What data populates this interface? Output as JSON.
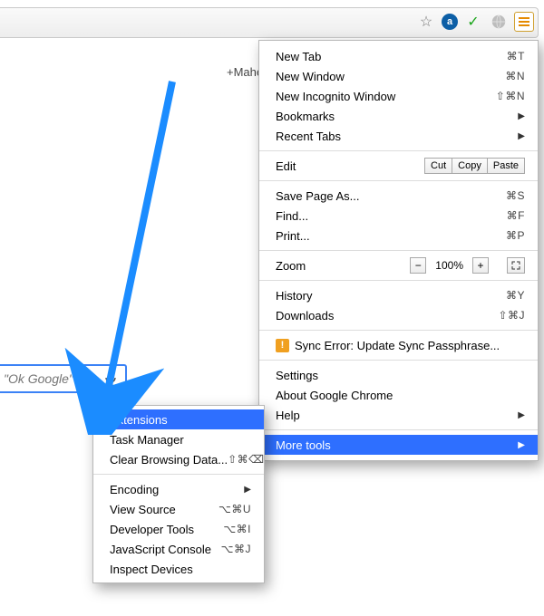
{
  "toolbar": {
    "star": "☆",
    "a": "a",
    "check": "✓"
  },
  "userlink": "+Mahesh",
  "search": {
    "placeholder": "\"Ok Google\""
  },
  "menu": {
    "newtab": {
      "label": "New Tab",
      "sc": "⌘T"
    },
    "newwin": {
      "label": "New Window",
      "sc": "⌘N"
    },
    "incog": {
      "label": "New Incognito Window",
      "sc": "⇧⌘N"
    },
    "bookmarks": {
      "label": "Bookmarks"
    },
    "recent": {
      "label": "Recent Tabs"
    },
    "edit": {
      "label": "Edit",
      "cut": "Cut",
      "copy": "Copy",
      "paste": "Paste"
    },
    "save": {
      "label": "Save Page As...",
      "sc": "⌘S"
    },
    "find": {
      "label": "Find...",
      "sc": "⌘F"
    },
    "print": {
      "label": "Print...",
      "sc": "⌘P"
    },
    "zoom": {
      "label": "Zoom",
      "minus": "−",
      "pct": "100%",
      "plus": "+"
    },
    "history": {
      "label": "History",
      "sc": "⌘Y"
    },
    "downloads": {
      "label": "Downloads",
      "sc": "⇧⌘J"
    },
    "sync": {
      "label": "Sync Error: Update Sync Passphrase..."
    },
    "settings": {
      "label": "Settings"
    },
    "about": {
      "label": "About Google Chrome"
    },
    "help": {
      "label": "Help"
    },
    "more": {
      "label": "More tools"
    }
  },
  "submenu": {
    "ext": {
      "label": "Extensions"
    },
    "task": {
      "label": "Task Manager"
    },
    "clear": {
      "label": "Clear Browsing Data...",
      "sc": "⇧⌘⌫"
    },
    "enc": {
      "label": "Encoding"
    },
    "vsrc": {
      "label": "View Source",
      "sc": "⌥⌘U"
    },
    "devt": {
      "label": "Developer Tools",
      "sc": "⌥⌘I"
    },
    "jsc": {
      "label": "JavaScript Console",
      "sc": "⌥⌘J"
    },
    "insp": {
      "label": "Inspect Devices"
    }
  }
}
